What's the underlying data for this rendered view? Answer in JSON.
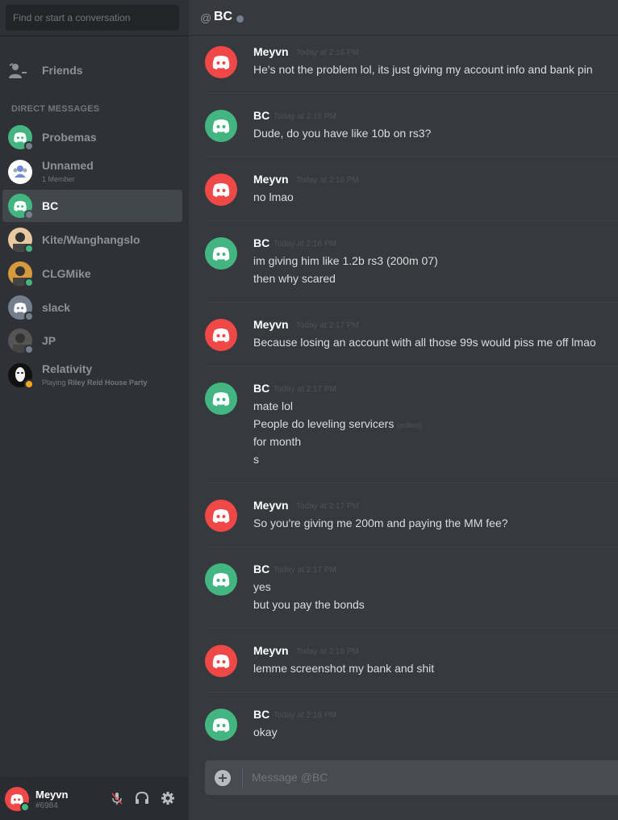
{
  "search": {
    "placeholder": "Find or start a conversation"
  },
  "friends": {
    "label": "Friends"
  },
  "dm_header": "DIRECT MESSAGES",
  "dms": [
    {
      "name": "Probemas",
      "sub": "",
      "avatar": "discord-logo-icon",
      "avatar_color": "#43b581",
      "status_color": "#747f8d",
      "active": false
    },
    {
      "name": "Unnamed",
      "sub": "1 Member",
      "avatar": "group-icon",
      "avatar_color": "#ffffff",
      "status_color": "",
      "active": false
    },
    {
      "name": "BC",
      "sub": "",
      "avatar": "discord-logo-icon",
      "avatar_color": "#43b581",
      "status_color": "#747f8d",
      "active": true
    },
    {
      "name": "Kite/Wanghangslo",
      "sub": "",
      "avatar": "anime-avatar-icon",
      "avatar_color": "#e8c9a0",
      "status_color": "#43b581",
      "active": false
    },
    {
      "name": "CLGMike",
      "sub": "",
      "avatar": "character-avatar-icon",
      "avatar_color": "#d69a3c",
      "status_color": "#43b581",
      "active": false
    },
    {
      "name": "slack",
      "sub": "",
      "avatar": "discord-logo-icon",
      "avatar_color": "#747f8d",
      "status_color": "#747f8d",
      "active": false
    },
    {
      "name": "JP",
      "sub": "",
      "avatar": "photo-avatar-icon",
      "avatar_color": "#555555",
      "status_color": "#747f8d",
      "active": false
    },
    {
      "name": "Relativity",
      "sub_prefix": "Playing ",
      "sub_bold": "Riley Reid House Party",
      "avatar": "mask-avatar-icon",
      "avatar_color": "#111111",
      "status_color": "#faa61a",
      "active": false
    }
  ],
  "user": {
    "name": "Meyvn",
    "tag": "#6984",
    "avatar_color": "#f04747",
    "status_color": "#43b581"
  },
  "header": {
    "at": "@",
    "name": "BC"
  },
  "messages": [
    {
      "author": "Meyvn",
      "time": "Today at 2:16 PM",
      "color": "#f04747",
      "lines": [
        "He's not the problem lol, its just giving my account info and bank pin"
      ]
    },
    {
      "author": "BC",
      "time": "Today at 2:16 PM",
      "color": "#43b581",
      "lines": [
        "Dude, do you have like 10b on rs3?"
      ]
    },
    {
      "author": "Meyvn",
      "time": "Today at 2:16 PM",
      "color": "#f04747",
      "lines": [
        "no lmao"
      ]
    },
    {
      "author": "BC",
      "time": "Today at 2:16 PM",
      "color": "#43b581",
      "lines": [
        "im giving him like 1.2b rs3 (200m 07)",
        "then why scared"
      ]
    },
    {
      "author": "Meyvn",
      "time": "Today at 2:17 PM",
      "color": "#f04747",
      "lines": [
        "Because losing an account with all those 99s would piss me off lmao"
      ]
    },
    {
      "author": "BC",
      "time": "Today at 2:17 PM",
      "color": "#43b581",
      "lines": [
        "mate lol",
        "People do leveling servicers",
        "for month",
        "s"
      ],
      "edited": "(edited)"
    },
    {
      "author": "Meyvn",
      "time": "Today at 2:17 PM",
      "color": "#f04747",
      "lines": [
        "So you're giving me 200m and paying the MM fee?"
      ]
    },
    {
      "author": "BC",
      "time": "Today at 2:17 PM",
      "color": "#43b581",
      "lines": [
        "yes",
        "but you pay the bonds"
      ]
    },
    {
      "author": "Meyvn",
      "time": "Today at 2:18 PM",
      "color": "#f04747",
      "lines": [
        "lemme screenshot my bank and shit"
      ]
    },
    {
      "author": "BC",
      "time": "Today at 2:18 PM",
      "color": "#43b581",
      "lines": [
        "okay"
      ]
    }
  ],
  "composer": {
    "placeholder": "Message @BC"
  }
}
